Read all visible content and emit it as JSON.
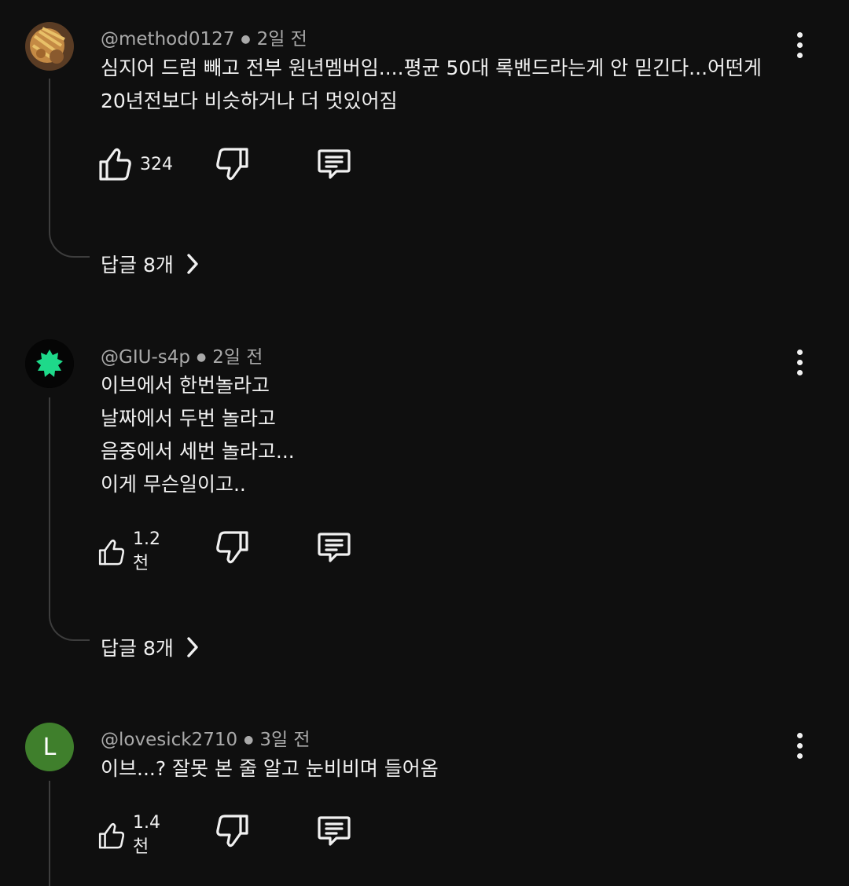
{
  "comments": [
    {
      "handle": "@method0127",
      "time": "2일 전",
      "text": "심지어 드럼 빼고 전부 원년멤버임....평균 50대 록밴드라는게 안 믿긴다...어떤게\n20년전보다 비슷하거나 더 멋있어짐",
      "likes": "324",
      "replies": "답글 8개",
      "avatar_type": "photo"
    },
    {
      "handle": "@GIU-s4p",
      "time": "2일 전",
      "text": "이브에서 한번놀라고\n날짜에서 두번 놀라고\n음중에서 세번 놀라고...\n이게 무슨일이고..",
      "likes": "1.2천",
      "replies": "답글 8개",
      "avatar_type": "badge"
    },
    {
      "handle": "@lovesick2710",
      "time": "3일 전",
      "text": "이브...? 잘못 본 줄 알고 눈비비며 들어옴",
      "likes": "1.4천",
      "avatar_letter": "L",
      "avatar_type": "letter"
    }
  ],
  "colors": {
    "background": "#0f0f0f",
    "meta_text": "#aaaaaa",
    "badge_green": "#1ed98a",
    "letter_avatar": "#3f7f2c"
  },
  "icons": [
    "thumbs-up-icon",
    "thumbs-down-icon",
    "reply-comment-icon",
    "more-vertical-icon",
    "chevron-right-icon"
  ]
}
